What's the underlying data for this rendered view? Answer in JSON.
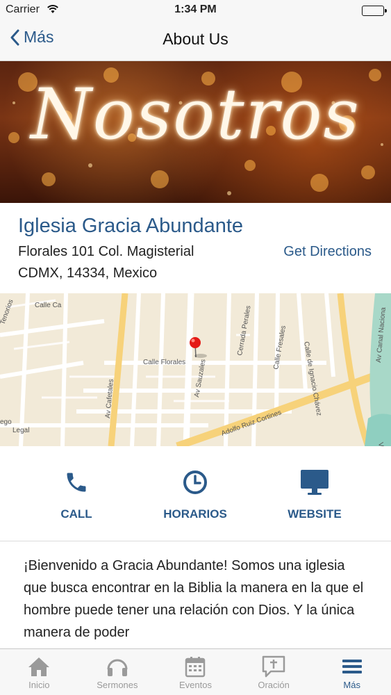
{
  "status_bar": {
    "carrier": "Carrier",
    "time": "1:34 PM"
  },
  "nav": {
    "back_label": "Más",
    "title": "About Us"
  },
  "hero": {
    "title": "Nosotros"
  },
  "church": {
    "name": "Iglesia Gracia Abundante",
    "address_line1": "Florales 101 Col. Magisterial",
    "address_line2": "CDMX,  14334, Mexico",
    "directions_label": "Get Directions"
  },
  "map": {
    "streets": [
      "Tenorios",
      "Calle Ca",
      "Av Cafetales",
      "Calle Florales",
      "Av Sauzales",
      "Cerrada Perales",
      "Calle Fresales",
      "Calle de Ignacio Chávez",
      "Av Canal Naciona",
      "Adolfo Ruiz Cortines",
      "Legal",
      "ego",
      "Vacilo"
    ]
  },
  "actions": [
    {
      "label": "CALL",
      "icon": "phone-icon"
    },
    {
      "label": "HORARIOS",
      "icon": "clock-icon"
    },
    {
      "label": "WEBSITE",
      "icon": "monitor-icon"
    }
  ],
  "description": "¡Bienvenido a Gracia Abundante! Somos una iglesia que busca encontrar en la Biblia la manera en la que el hombre puede tener una relación con Dios. Y la única manera de poder",
  "tabs": [
    {
      "label": "Inicio",
      "icon": "home-icon",
      "active": false
    },
    {
      "label": "Sermones",
      "icon": "headphones-icon",
      "active": false
    },
    {
      "label": "Eventos",
      "icon": "calendar-icon",
      "active": false
    },
    {
      "label": "Oración",
      "icon": "prayer-bubble-icon",
      "active": false
    },
    {
      "label": "Más",
      "icon": "menu-icon",
      "active": true
    }
  ],
  "colors": {
    "accent": "#2b5a8a",
    "tab_inactive": "#9a9a9a",
    "bar_background": "#f7f7f7"
  }
}
